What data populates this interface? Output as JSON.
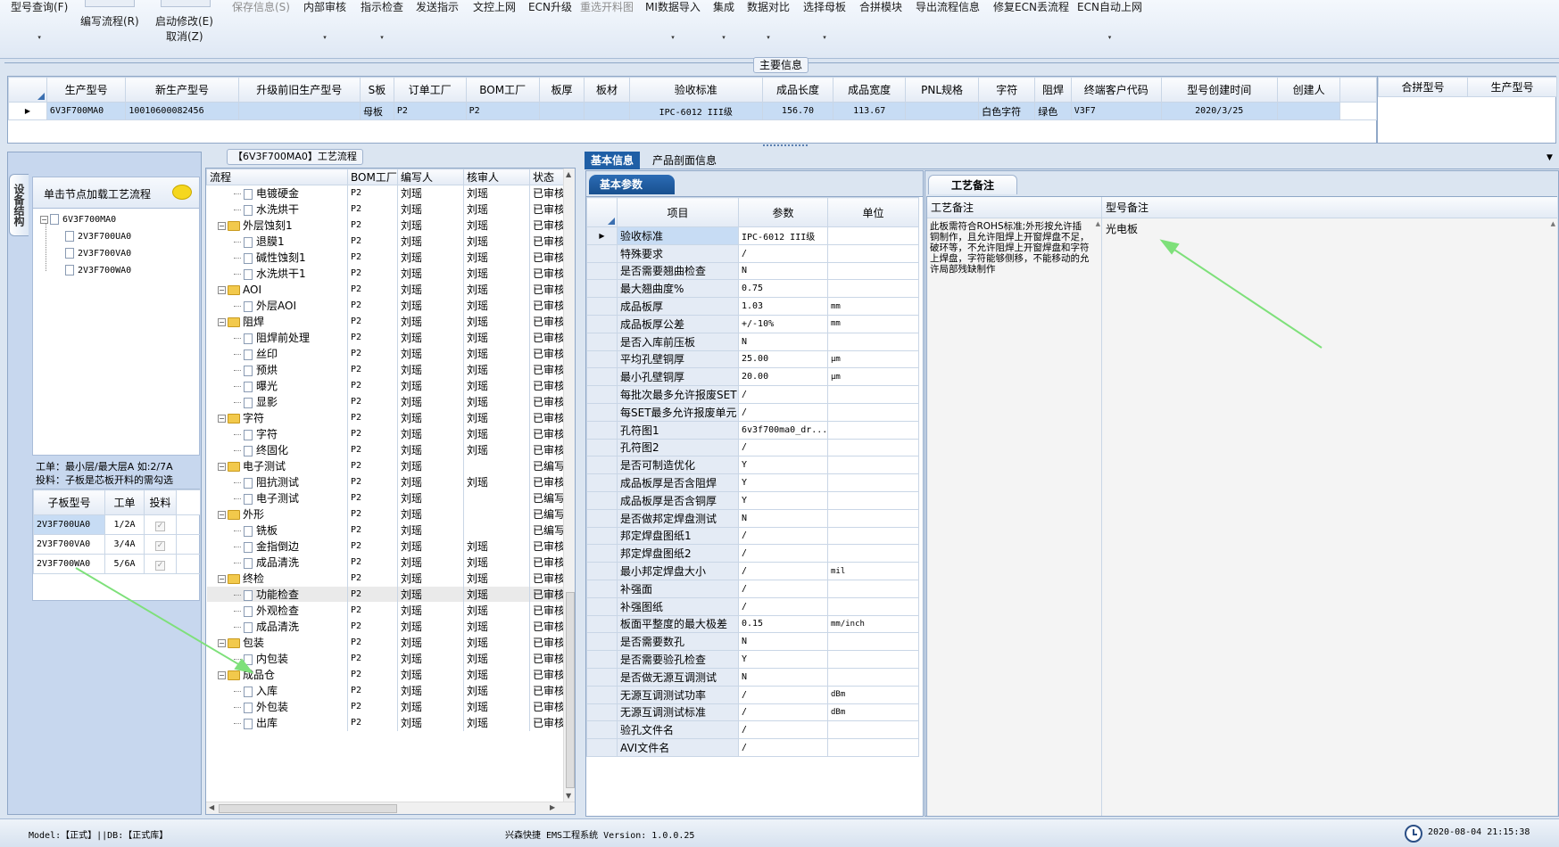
{
  "toolbar": {
    "items": [
      {
        "label": "型号查询(F)",
        "enabled": true
      },
      {
        "label": "编写流程(R)",
        "enabled": true
      },
      {
        "label": "启动修改(E)",
        "enabled": true
      },
      {
        "label": "取消(Z)",
        "enabled": true
      },
      {
        "label": "保存信息(S)",
        "enabled": false
      },
      {
        "label": "内部审核",
        "enabled": true
      },
      {
        "label": "指示检查",
        "enabled": true
      },
      {
        "label": "发送指示",
        "enabled": true
      },
      {
        "label": "文控上网",
        "enabled": true
      },
      {
        "label": "ECN升级",
        "enabled": true
      },
      {
        "label": "重选开料图",
        "enabled": false
      },
      {
        "label": "MI数据导入",
        "enabled": true
      },
      {
        "label": "集成",
        "enabled": true
      },
      {
        "label": "数据对比",
        "enabled": true
      },
      {
        "label": "选择母板",
        "enabled": true
      },
      {
        "label": "合拼模块",
        "enabled": true
      },
      {
        "label": "导出流程信息",
        "enabled": true
      },
      {
        "label": "修复ECN丢流程",
        "enabled": true
      },
      {
        "label": "ECN自动上网",
        "enabled": true
      }
    ]
  },
  "main_info": {
    "title": "主要信息",
    "columns": [
      "生产型号",
      "新生产型号",
      "升级前旧生产型号",
      "S板",
      "订单工厂",
      "BOM工厂",
      "板厚",
      "板材",
      "验收标准",
      "成品长度",
      "成品宽度",
      "PNL规格",
      "字符",
      "阻焊",
      "终端客户代码",
      "型号创建时间",
      "创建人"
    ],
    "row": [
      "6V3F700MA0",
      "10010600082456",
      "",
      "母板",
      "P2",
      "P2",
      "",
      "",
      "IPC-6012 III级",
      "156.70",
      "113.67",
      "",
      "白色字符",
      "绿色",
      "V3F7",
      "2020/3/25",
      ""
    ],
    "side_columns": [
      "合拼型号",
      "生产型号"
    ]
  },
  "left_panel": {
    "vertical_tab": "设备结构",
    "load_hint": "单击节点加载工艺流程",
    "tree_root": "6V3F700MA0",
    "tree_children": [
      "2V3F700UA0",
      "2V3F700VA0",
      "2V3F700WA0"
    ],
    "info_line1": "工单：最小层/最大层A 如:2/7A",
    "info_line2": "投料：子板是芯板开料的需勾选",
    "sub_columns": [
      "子板型号",
      "工单",
      "投料"
    ],
    "sub_rows": [
      {
        "model": "2V3F700UA0",
        "order": "1/2A",
        "feed": "✓"
      },
      {
        "model": "2V3F700VA0",
        "order": "3/4A",
        "feed": "✓"
      },
      {
        "model": "2V3F700WA0",
        "order": "5/6A",
        "feed": "✓"
      }
    ]
  },
  "process": {
    "title": "【6V3F700MA0】工艺流程",
    "columns": [
      "流程",
      "BOM工厂",
      "编写人",
      "核审人",
      "状态"
    ],
    "rows": [
      {
        "name": "电镀硬金",
        "type": "item",
        "bom": "P2",
        "author": "刘瑶",
        "reviewer": "刘瑶",
        "status": "已审核"
      },
      {
        "name": "水洗烘干",
        "type": "item",
        "bom": "P2",
        "author": "刘瑶",
        "reviewer": "刘瑶",
        "status": "已审核"
      },
      {
        "name": "外层蚀刻1",
        "type": "group",
        "bom": "P2",
        "author": "刘瑶",
        "reviewer": "刘瑶",
        "status": "已审核"
      },
      {
        "name": "退膜1",
        "type": "item",
        "bom": "P2",
        "author": "刘瑶",
        "reviewer": "刘瑶",
        "status": "已审核"
      },
      {
        "name": "碱性蚀刻1",
        "type": "item",
        "bom": "P2",
        "author": "刘瑶",
        "reviewer": "刘瑶",
        "status": "已审核"
      },
      {
        "name": "水洗烘干1",
        "type": "item",
        "bom": "P2",
        "author": "刘瑶",
        "reviewer": "刘瑶",
        "status": "已审核"
      },
      {
        "name": "AOI",
        "type": "group",
        "bom": "P2",
        "author": "刘瑶",
        "reviewer": "刘瑶",
        "status": "已审核"
      },
      {
        "name": "外层AOI",
        "type": "item",
        "bom": "P2",
        "author": "刘瑶",
        "reviewer": "刘瑶",
        "status": "已审核"
      },
      {
        "name": "阻焊",
        "type": "group",
        "bom": "P2",
        "author": "刘瑶",
        "reviewer": "刘瑶",
        "status": "已审核"
      },
      {
        "name": "阻焊前处理",
        "type": "item",
        "bom": "P2",
        "author": "刘瑶",
        "reviewer": "刘瑶",
        "status": "已审核"
      },
      {
        "name": "丝印",
        "type": "item",
        "bom": "P2",
        "author": "刘瑶",
        "reviewer": "刘瑶",
        "status": "已审核"
      },
      {
        "name": "预烘",
        "type": "item",
        "bom": "P2",
        "author": "刘瑶",
        "reviewer": "刘瑶",
        "status": "已审核"
      },
      {
        "name": "曝光",
        "type": "item",
        "bom": "P2",
        "author": "刘瑶",
        "reviewer": "刘瑶",
        "status": "已审核"
      },
      {
        "name": "显影",
        "type": "item",
        "bom": "P2",
        "author": "刘瑶",
        "reviewer": "刘瑶",
        "status": "已审核"
      },
      {
        "name": "字符",
        "type": "group",
        "bom": "P2",
        "author": "刘瑶",
        "reviewer": "刘瑶",
        "status": "已审核"
      },
      {
        "name": "字符",
        "type": "item",
        "bom": "P2",
        "author": "刘瑶",
        "reviewer": "刘瑶",
        "status": "已审核"
      },
      {
        "name": "终固化",
        "type": "item",
        "bom": "P2",
        "author": "刘瑶",
        "reviewer": "刘瑶",
        "status": "已审核"
      },
      {
        "name": "电子测试",
        "type": "group",
        "bom": "P2",
        "author": "刘瑶",
        "reviewer": "",
        "status": "已编写"
      },
      {
        "name": "阻抗测试",
        "type": "item",
        "bom": "P2",
        "author": "刘瑶",
        "reviewer": "刘瑶",
        "status": "已审核"
      },
      {
        "name": "电子测试",
        "type": "item",
        "bom": "P2",
        "author": "刘瑶",
        "reviewer": "",
        "status": "已编写"
      },
      {
        "name": "外形",
        "type": "group",
        "bom": "P2",
        "author": "刘瑶",
        "reviewer": "",
        "status": "已编写"
      },
      {
        "name": "铣板",
        "type": "item",
        "bom": "P2",
        "author": "刘瑶",
        "reviewer": "",
        "status": "已编写"
      },
      {
        "name": "金指倒边",
        "type": "item",
        "bom": "P2",
        "author": "刘瑶",
        "reviewer": "刘瑶",
        "status": "已审核"
      },
      {
        "name": "成品清洗",
        "type": "item",
        "bom": "P2",
        "author": "刘瑶",
        "reviewer": "刘瑶",
        "status": "已审核"
      },
      {
        "name": "终检",
        "type": "group",
        "bom": "P2",
        "author": "刘瑶",
        "reviewer": "刘瑶",
        "status": "已审核"
      },
      {
        "name": "功能检查",
        "type": "item",
        "bom": "P2",
        "author": "刘瑶",
        "reviewer": "刘瑶",
        "status": "已审核"
      },
      {
        "name": "外观检查",
        "type": "item",
        "bom": "P2",
        "author": "刘瑶",
        "reviewer": "刘瑶",
        "status": "已审核"
      },
      {
        "name": "成品清洗",
        "type": "item",
        "bom": "P2",
        "author": "刘瑶",
        "reviewer": "刘瑶",
        "status": "已审核"
      },
      {
        "name": "包装",
        "type": "group",
        "bom": "P2",
        "author": "刘瑶",
        "reviewer": "刘瑶",
        "status": "已审核"
      },
      {
        "name": "内包装",
        "type": "item",
        "bom": "P2",
        "author": "刘瑶",
        "reviewer": "刘瑶",
        "status": "已审核"
      },
      {
        "name": "成品仓",
        "type": "group",
        "bom": "P2",
        "author": "刘瑶",
        "reviewer": "刘瑶",
        "status": "已审核"
      },
      {
        "name": "入库",
        "type": "item",
        "bom": "P2",
        "author": "刘瑶",
        "reviewer": "刘瑶",
        "status": "已审核"
      },
      {
        "name": "外包装",
        "type": "item",
        "bom": "P2",
        "author": "刘瑶",
        "reviewer": "刘瑶",
        "status": "已审核"
      },
      {
        "name": "出库",
        "type": "item",
        "bom": "P2",
        "author": "刘瑶",
        "reviewer": "刘瑶",
        "status": "已审核"
      }
    ]
  },
  "detail": {
    "tabs": [
      "基本信息",
      "产品剖面信息"
    ],
    "subtab": "基本参数",
    "columns": [
      "项目",
      "参数",
      "单位"
    ],
    "rows": [
      [
        "验收标准",
        "IPC-6012 III级",
        ""
      ],
      [
        "特殊要求",
        "/",
        ""
      ],
      [
        "是否需要翘曲检查",
        "N",
        ""
      ],
      [
        "最大翘曲度%",
        "0.75",
        ""
      ],
      [
        "成品板厚",
        "1.03",
        "mm"
      ],
      [
        "成品板厚公差",
        "+/-10%",
        "mm"
      ],
      [
        "是否入库前压板",
        "N",
        ""
      ],
      [
        "平均孔壁铜厚",
        "25.00",
        "μm"
      ],
      [
        "最小孔壁铜厚",
        "20.00",
        "μm"
      ],
      [
        "每批次最多允许报废SET",
        "/",
        ""
      ],
      [
        "每SET最多允许报废单元",
        "/",
        ""
      ],
      [
        "孔符图1",
        "6v3f700ma0_dr...",
        ""
      ],
      [
        "孔符图2",
        "/",
        ""
      ],
      [
        "是否可制造优化",
        "Y",
        ""
      ],
      [
        "成品板厚是否含阻焊",
        "Y",
        ""
      ],
      [
        "成品板厚是否含铜厚",
        "Y",
        ""
      ],
      [
        "是否做邦定焊盘测试",
        "N",
        ""
      ],
      [
        "邦定焊盘图纸1",
        "/",
        ""
      ],
      [
        "邦定焊盘图纸2",
        "/",
        ""
      ],
      [
        "最小邦定焊盘大小",
        "/",
        "mil"
      ],
      [
        "补强面",
        "/",
        ""
      ],
      [
        "补强图纸",
        "/",
        ""
      ],
      [
        "板面平整度的最大极差",
        "0.15",
        "mm/inch"
      ],
      [
        "是否需要数孔",
        "N",
        ""
      ],
      [
        "是否需要验孔检查",
        "Y",
        ""
      ],
      [
        "是否做无源互调测试",
        "N",
        ""
      ],
      [
        "无源互调测试功率",
        "/",
        "dBm"
      ],
      [
        "无源互调测试标准",
        "/",
        "dBm"
      ],
      [
        "验孔文件名",
        "/",
        ""
      ],
      [
        "AVI文件名",
        "/",
        ""
      ]
    ]
  },
  "remarks": {
    "tab": "工艺备注",
    "col1": "工艺备注",
    "col2": "型号备注",
    "process_note": "此板需符合ROHS标准;外形按允许插铜制作，且允许阻焊上开窗焊盘不足，破环等，不允许阻焊上开窗焊盘和字符上焊盘，字符能够侧移，不能移动的允许局部残缺制作",
    "model_note": "光电板"
  },
  "statusbar": {
    "left": "Model:【正式】||DB:【正式库】",
    "center": "兴森快捷 EMS工程系统 Version: 1.0.0.25",
    "datetime": "2020-08-04 21:15:38"
  }
}
